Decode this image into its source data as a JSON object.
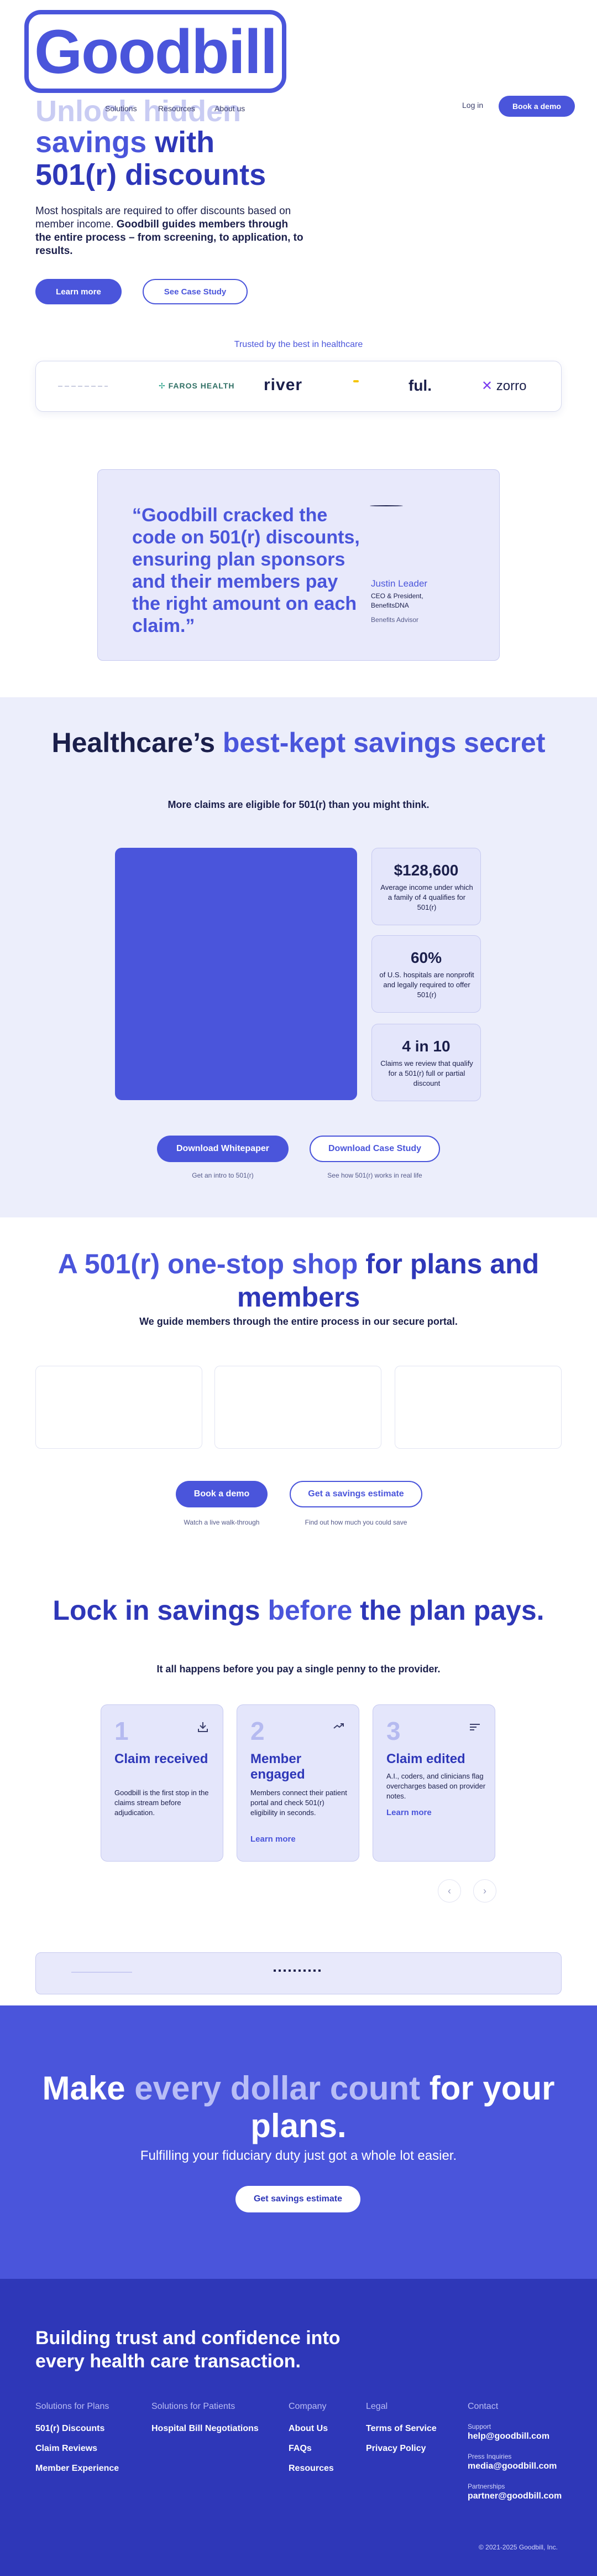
{
  "header": {
    "logo": "Goodbill",
    "nav": [
      "Solutions",
      "Resources",
      "About us"
    ],
    "login": "Log in",
    "book_demo": "Book a demo"
  },
  "hero": {
    "title_faded": "Unlock hidden",
    "title_line2_a": "savings",
    "title_line2_b": " with",
    "title_line3": "501(r) discounts",
    "subtitle_plain": "Most hospitals are required to offer discounts based on member income. ",
    "subtitle_bold": "Goodbill guides members through the entire process – from screening, to application, to results.",
    "learn_more": "Learn more",
    "see_case_study": "See Case Study"
  },
  "trusted": {
    "label": "Trusted by the best in healthcare",
    "logos": [
      "FAROS HEALTH",
      "river",
      "ful.",
      "zorro"
    ]
  },
  "testimonial": {
    "quote": "“Goodbill cracked the code on 501(r) discounts, ensuring plan sponsors and their members pay the right amount on each claim.”",
    "name": "Justin Leader",
    "title": "CEO & President, BenefitsDNA",
    "role": "Benefits Advisor"
  },
  "secret": {
    "title_a": "Healthcare’s ",
    "title_b": "best-kept savings secret",
    "subtitle": "More claims are eligible for 501(r) than you might think.",
    "stats": [
      {
        "value": "$128,600",
        "desc": "Average income under which a family of 4 qualifies for 501(r)"
      },
      {
        "value": "60%",
        "desc": "of U.S. hospitals are nonprofit and legally required to offer 501(r)"
      },
      {
        "value": "4 in 10",
        "desc": "Claims we review that qualify for a 501(r) full or partial discount"
      }
    ],
    "download_whitepaper": "Download Whitepaper",
    "download_case_study": "Download Case Study",
    "whitepaper_caption": "Get an intro to 501(r)",
    "case_study_caption": "See how 501(r) works in real life"
  },
  "onestop": {
    "title_a": "A 501(r) one-stop shop",
    "title_b": " for plans and members",
    "subtitle": "We guide members through the entire process in our secure portal.",
    "book_demo": "Book a demo",
    "savings_estimate": "Get a savings estimate",
    "demo_caption": "Watch a live walk-through",
    "estimate_caption": "Find out how much you could save"
  },
  "lock": {
    "title_a": "Lock in savings ",
    "title_b": "before",
    "title_c": " the plan pays.",
    "subtitle": "It all happens before you pay a single penny to the provider.",
    "steps": [
      {
        "num": "1",
        "title": "Claim received",
        "desc": "Goodbill is the first stop in the claims stream before adjudication.",
        "more": ""
      },
      {
        "num": "2",
        "title": "Member engaged",
        "desc": "Members connect their patient portal and check 501(r) eligibility in seconds.",
        "more": "Learn more"
      },
      {
        "num": "3",
        "title": "Claim edited",
        "desc": "A.I., coders, and clinicians flag overcharges based on provider notes.",
        "more": "Learn more"
      }
    ],
    "prev": "‹",
    "next": "›"
  },
  "cta": {
    "title_a": "Make ",
    "title_b": "every dollar count",
    "title_c": " for your plans.",
    "subtitle": "Fulfilling your fiduciary duty just got a whole lot easier.",
    "button": "Get savings estimate"
  },
  "footer": {
    "tagline": "Building trust and confidence into every health care transaction.",
    "plans_head": "Solutions for Plans",
    "plans_links": [
      "501(r) Discounts",
      "Claim Reviews",
      "Member Experience"
    ],
    "patients_head": "Solutions for Patients",
    "patients_links": [
      "Hospital Bill Negotiations"
    ],
    "company_head": "Company",
    "company_links": [
      "About Us",
      "FAQs",
      "Resources"
    ],
    "legal_head": "Legal",
    "legal_links": [
      "Terms of Service",
      "Privacy Policy"
    ],
    "contact_head": "Contact",
    "support_label": "Support",
    "support_email": "help@goodbill.com",
    "press_label": "Press Inquiries",
    "press_email": "media@goodbill.com",
    "partner_label": "Partnerships",
    "partner_email": "partner@goodbill.com",
    "copyright": "© 2021-2025 Goodbill, Inc."
  },
  "colors": {
    "brand": "#4a55db",
    "brand_dark": "#2e37b8",
    "light_panel": "#e8e9fb"
  }
}
